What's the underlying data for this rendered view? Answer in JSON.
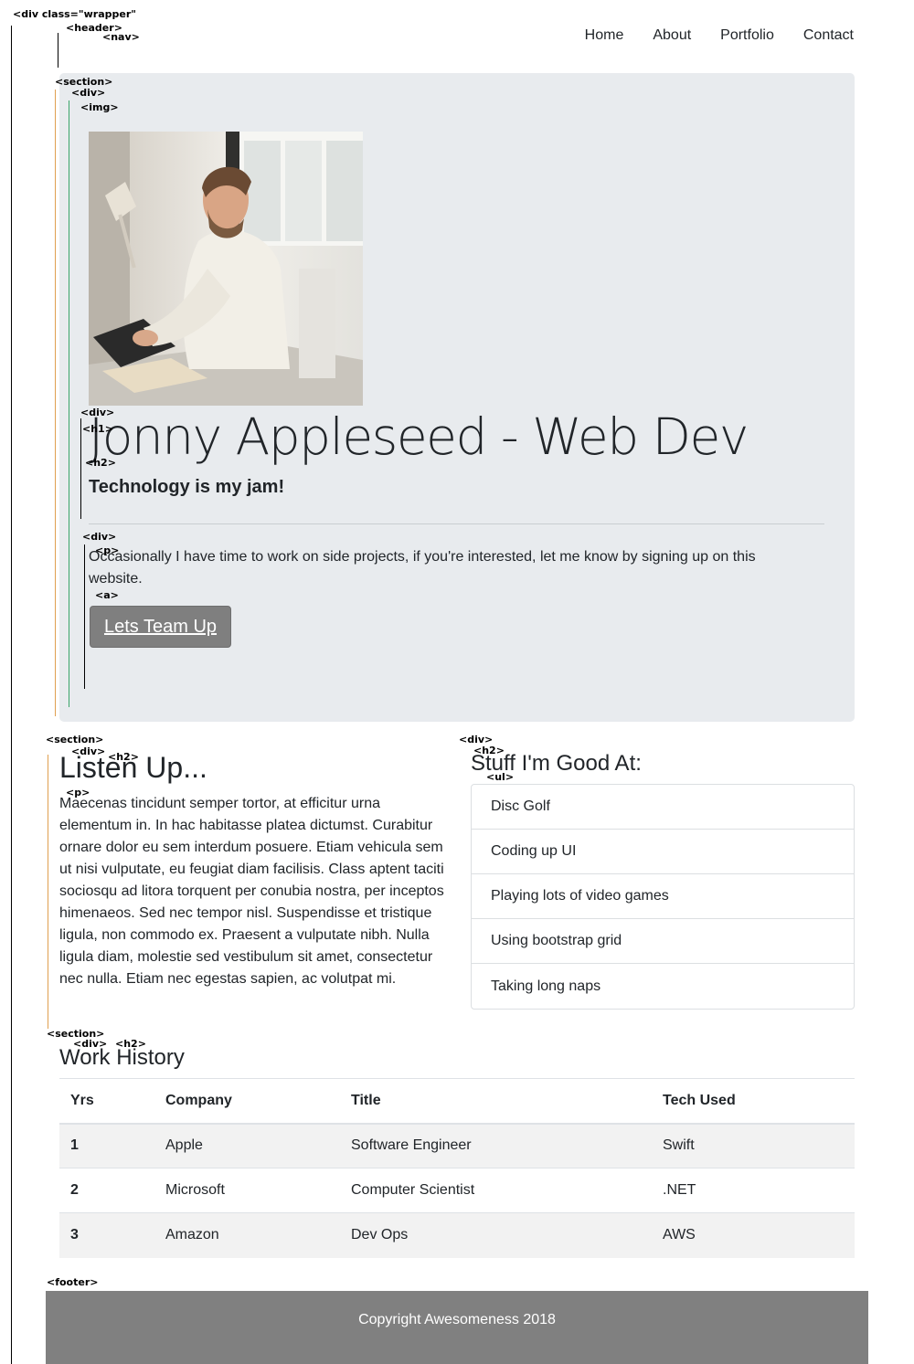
{
  "annotations": {
    "wrapper": "<div class=\"wrapper\"",
    "header": "<header>",
    "nav": "<nav>",
    "section": "<section>",
    "div": "<div>",
    "img": "<img>",
    "h1": "<h1>",
    "h2": "<h2>",
    "p": "<p>",
    "a": "<a>",
    "ul": "<ul>",
    "footer": "<footer>"
  },
  "nav": {
    "items": [
      "Home",
      "About",
      "Portfolio",
      "Contact"
    ]
  },
  "hero": {
    "image_alt": "Man smiling while typing on a computer keyboard",
    "title": "Jonny Appleseed - Web Dev",
    "subtitle": "Technology is my jam!",
    "text": "Occasionally I have time to work on side projects, if you're interested, let me know by signing up on this website.",
    "button": "Lets Team Up"
  },
  "listen": {
    "title": "Listen Up...",
    "text": "Maecenas tincidunt semper tortor, at efficitur urna elementum in. In hac habitasse platea dictumst. Curabitur ornare dolor eu sem interdum posuere. Etiam vehicula sem ut nisi vulputate, eu feugiat diam facilisis. Class aptent taciti sociosqu ad litora torquent per conubia nostra, per inceptos himenaeos. Sed nec tempor nisl. Suspendisse et tristique ligula, non commodo ex. Praesent a vulputate nibh. Nulla ligula diam, molestie sed vestibulum sit amet, consectetur nec nulla. Etiam nec egestas sapien, ac volutpat mi."
  },
  "skills": {
    "title": "Stuff I'm Good At:",
    "items": [
      "Disc Golf",
      "Coding up UI",
      "Playing lots of video games",
      "Using bootstrap grid",
      "Taking long naps"
    ]
  },
  "work": {
    "title": "Work History",
    "columns": [
      "Yrs",
      "Company",
      "Title",
      "Tech Used"
    ],
    "rows": [
      [
        "1",
        "Apple",
        "Software Engineer",
        "Swift"
      ],
      [
        "2",
        "Microsoft",
        "Computer Scientist",
        ".NET"
      ],
      [
        "3",
        "Amazon",
        "Dev Ops",
        "AWS"
      ]
    ]
  },
  "footer": {
    "text": "Copyright Awesomeness 2018"
  },
  "colors": {
    "jumbotron_bg": "#e8ebee",
    "button_bg": "#7f7f7f",
    "footer_bg": "#808080",
    "table_stripe": "#f2f2f2"
  }
}
